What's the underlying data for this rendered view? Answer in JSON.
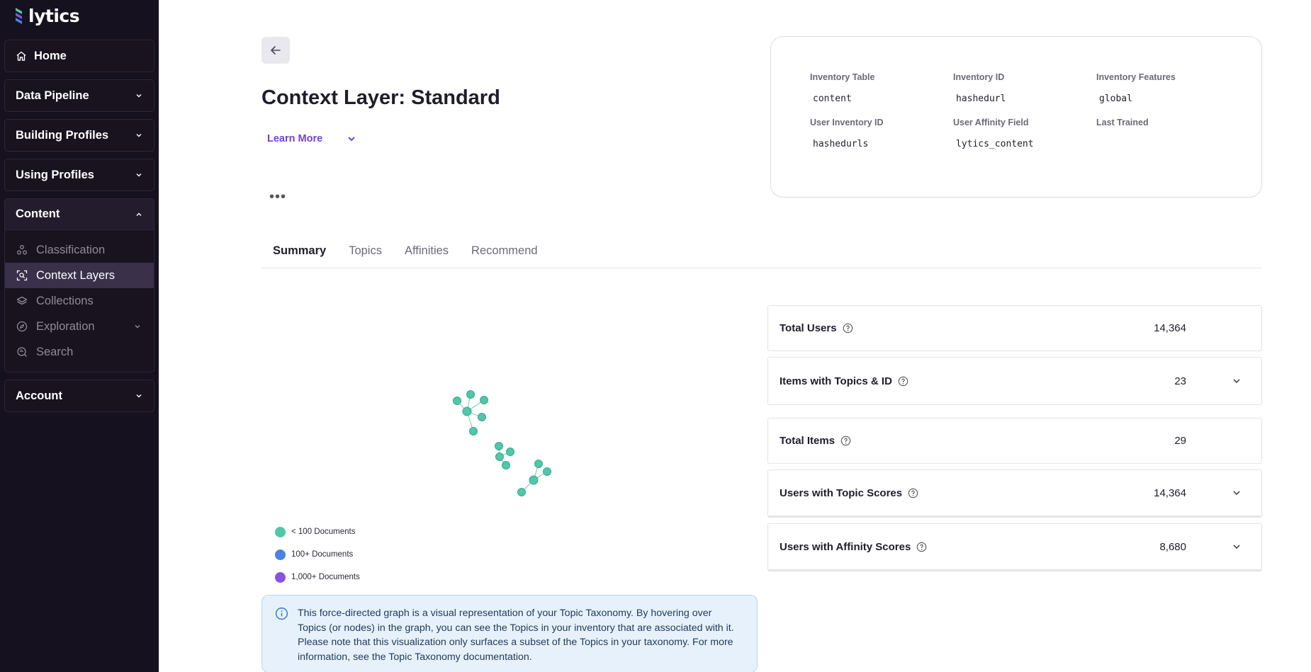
{
  "brand": {
    "name": "lytics",
    "accent": "#6e43d8"
  },
  "sidebar": {
    "home": {
      "label": "Home",
      "icon": "home-icon"
    },
    "groups": [
      {
        "label": "Data Pipeline"
      },
      {
        "label": "Building Profiles"
      },
      {
        "label": "Using Profiles"
      }
    ],
    "content": {
      "label": "Content",
      "items": [
        {
          "label": "Classification",
          "icon": "classification-icon"
        },
        {
          "label": "Context Layers",
          "icon": "context-layers-icon",
          "active": true
        },
        {
          "label": "Collections",
          "icon": "collections-icon"
        },
        {
          "label": "Exploration",
          "icon": "exploration-icon",
          "expandable": true
        },
        {
          "label": "Search",
          "icon": "search-icon"
        }
      ]
    },
    "account": {
      "label": "Account"
    }
  },
  "header": {
    "title": "Context Layer: Standard",
    "learn_more": "Learn More",
    "more": "•••"
  },
  "info": {
    "inventory_table": {
      "label": "Inventory Table",
      "value": "content"
    },
    "inventory_id": {
      "label": "Inventory ID",
      "value": "hashedurl"
    },
    "inventory_features": {
      "label": "Inventory Features",
      "value": "global"
    },
    "user_inventory_id": {
      "label": "User Inventory ID",
      "value": "hashedurls"
    },
    "user_affinity_field": {
      "label": "User Affinity Field",
      "value": "lytics_content"
    },
    "last_trained": {
      "label": "Last Trained",
      "value": ""
    }
  },
  "tabs": [
    {
      "label": "Summary",
      "active": true
    },
    {
      "label": "Topics"
    },
    {
      "label": "Affinities"
    },
    {
      "label": "Recommend"
    }
  ],
  "legend": [
    {
      "label": "< 100 Documents",
      "color": "#4fc7a8"
    },
    {
      "label": "100+ Documents",
      "color": "#4a82e6"
    },
    {
      "label": "1,000+ Documents",
      "color": "#8a52e0"
    }
  ],
  "notice": {
    "text": "This force-directed graph is a visual representation of your Topic Taxonomy. By hovering over Topics (or nodes) in the graph, you can see the Topics in your inventory that are associated with it. Please note that this visualization only surfaces a subset of the Topics in your taxonomy. For more information, see the ",
    "link": "Topic Taxonomy documentation",
    "end": "."
  },
  "stats": [
    {
      "label": "Total Users",
      "value": "14,364",
      "expandable": false
    },
    {
      "label": "Items with Topics & ID",
      "value": "23",
      "expandable": true
    },
    {
      "label": "Total Items",
      "value": "29",
      "expandable": false
    },
    {
      "label": "Users with Topic Scores",
      "value": "14,364",
      "expandable": true
    },
    {
      "label": "Users with Affinity Scores",
      "value": "8,680",
      "expandable": true
    }
  ]
}
